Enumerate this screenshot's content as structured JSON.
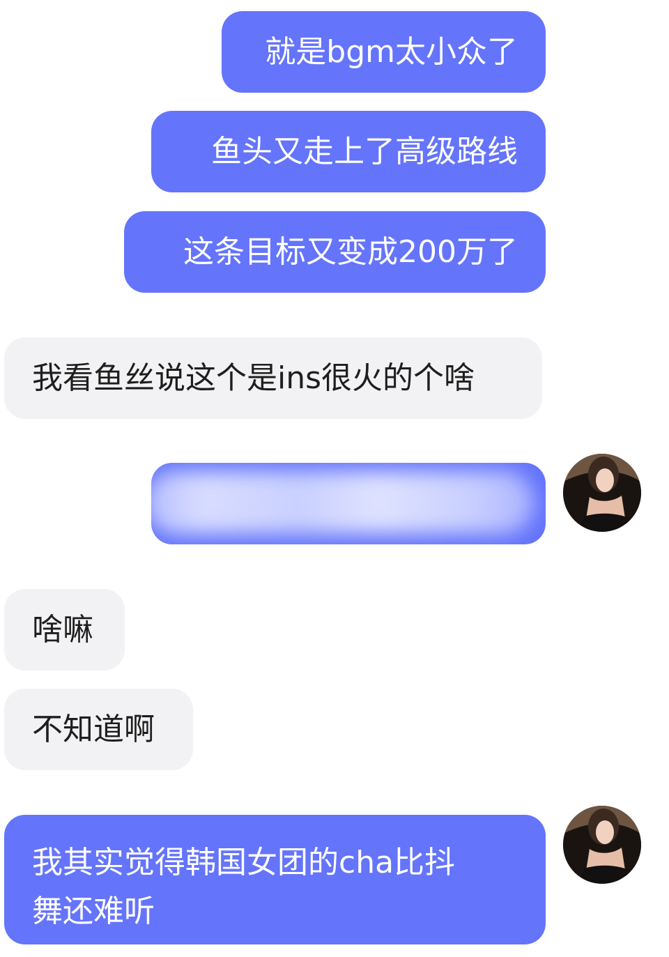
{
  "messages": [
    {
      "side": "sent",
      "text": "就是bgm太小众了"
    },
    {
      "side": "sent",
      "text": "鱼头又走上了高级路线"
    },
    {
      "side": "sent",
      "text": "这条目标又变成200万了"
    },
    {
      "side": "received",
      "text": "我看鱼丝说这个是ins很火的个啥"
    },
    {
      "side": "sent",
      "text": "",
      "blurred": true
    },
    {
      "side": "received",
      "text": "啥嘛"
    },
    {
      "side": "received",
      "text": "不知道啊"
    },
    {
      "side": "sent",
      "lines": [
        "我其实觉得韩国女团的cha比抖",
        "舞还难听"
      ]
    }
  ],
  "colors": {
    "sent_bubble": "#6474fb",
    "received_bubble": "#f2f2f4",
    "sent_text": "#ffffff",
    "received_text": "#1e1e1e"
  }
}
